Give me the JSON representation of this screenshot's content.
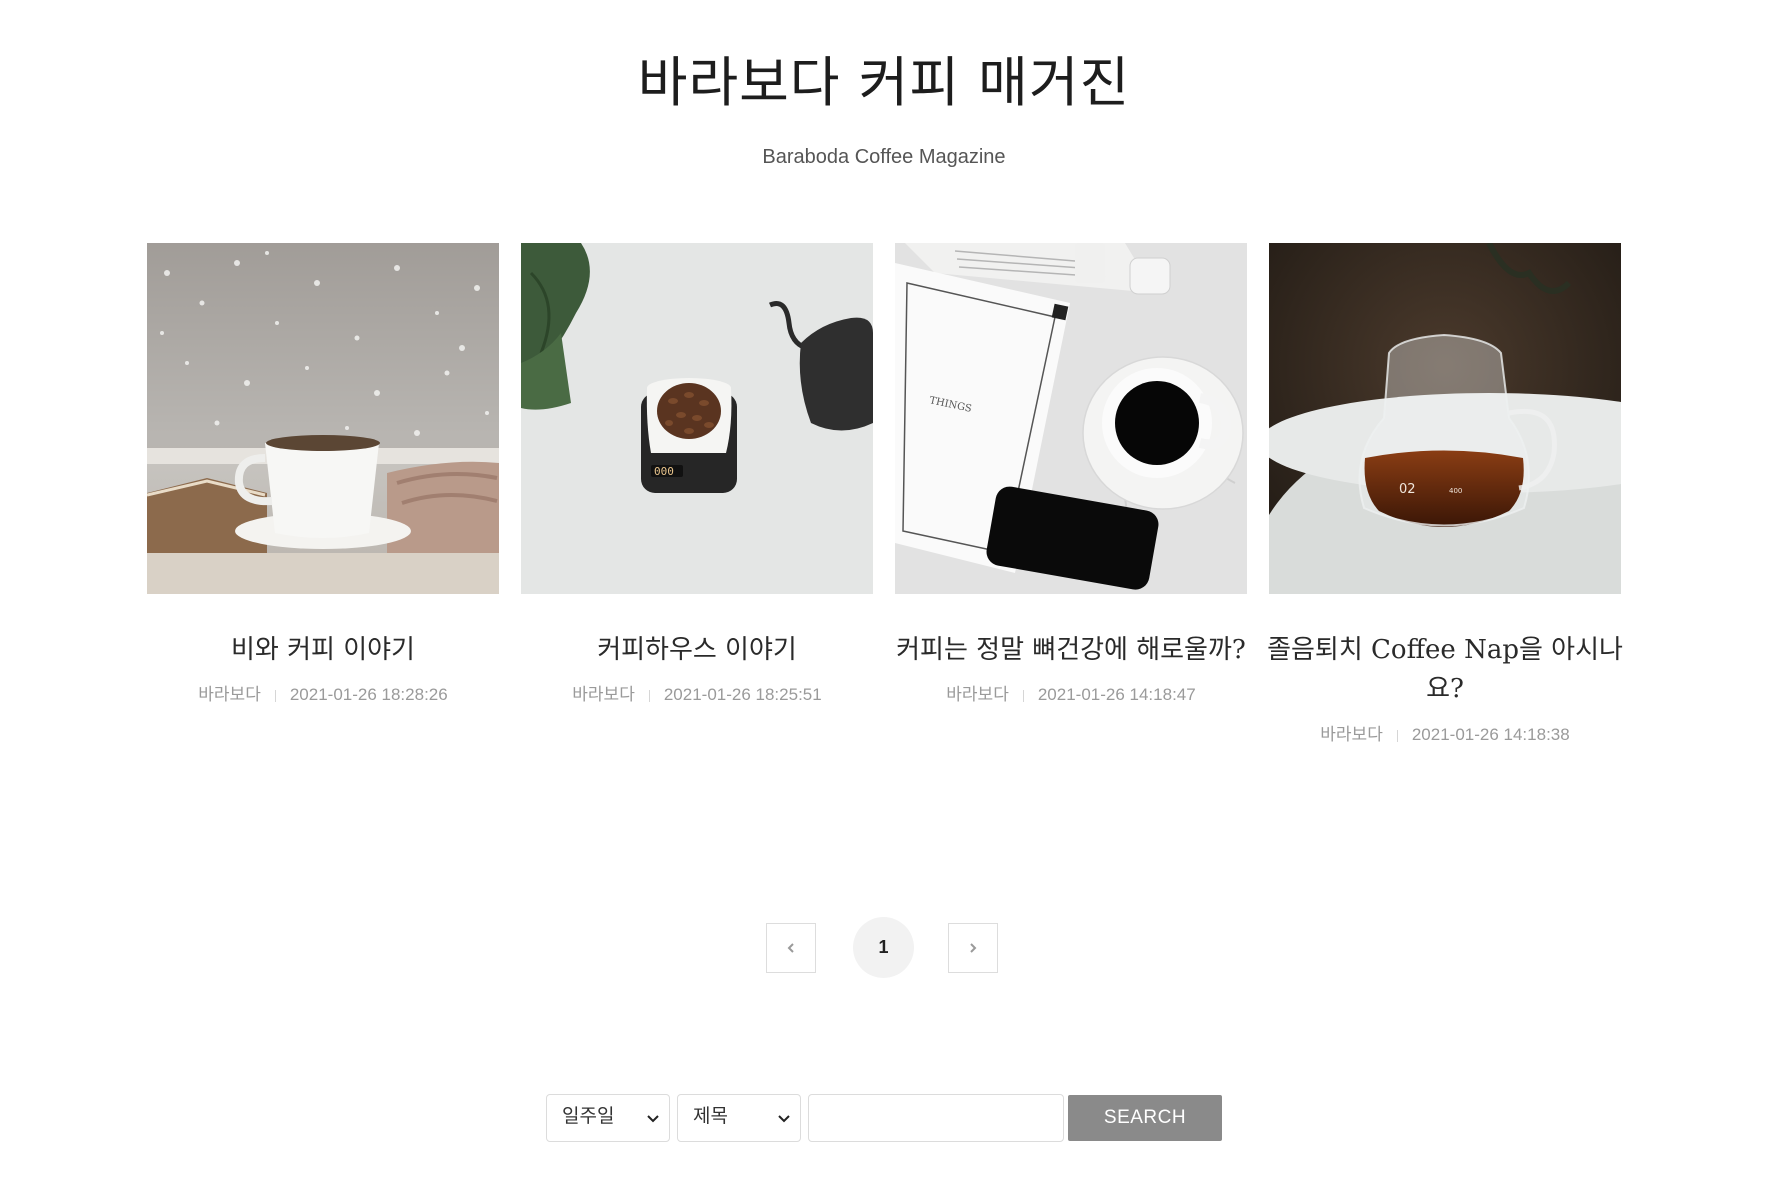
{
  "header": {
    "title": "바라보다 커피 매거진",
    "subtitle": "Baraboda Coffee Magazine"
  },
  "posts": [
    {
      "title": "비와 커피 이야기",
      "author": "바라보다",
      "date": "2021-01-26 18:28:26",
      "image": "coffee-cup-rain-window-photo"
    },
    {
      "title": "커피하우스 이야기",
      "author": "바라보다",
      "date": "2021-01-26 18:25:51",
      "image": "coffee-beans-scale-kettle-photo"
    },
    {
      "title": "커피는 정말 뼈건강에 해로울까?",
      "author": "바라보다",
      "date": "2021-01-26 14:18:47",
      "image": "black-coffee-marble-phone-photo"
    },
    {
      "title": "졸음퇴치 Coffee Nap을 아시나요?",
      "author": "바라보다",
      "date": "2021-01-26 14:18:38",
      "image": "glass-coffee-server-photo"
    }
  ],
  "pagination": {
    "current_page": "1",
    "prev_icon": "chevron-left-icon",
    "next_icon": "chevron-right-icon"
  },
  "search": {
    "period_selected": "일주일",
    "field_selected": "제목",
    "query_value": "",
    "button_label": "SEARCH"
  },
  "colors": {
    "background": "#ffffff",
    "text_primary": "#222222",
    "meta_text": "#9a9a9a",
    "search_button": "#8a8a8a",
    "page_current_bg": "#f2f2f2"
  }
}
